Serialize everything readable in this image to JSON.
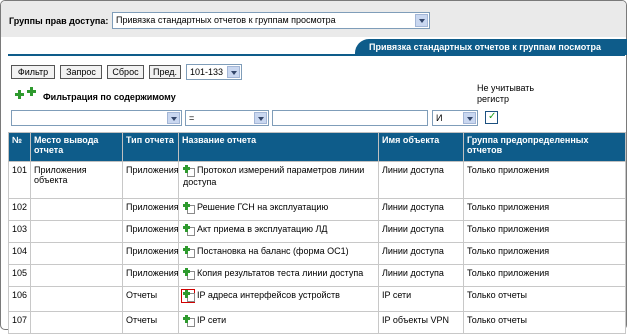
{
  "header": {
    "group_label": "Группы прав доступа:",
    "group_select_value": "Привязка стандартных отчетов к группам просмотра"
  },
  "title": "Привязка стандартных отчетов к группам посмотра",
  "toolbar": {
    "filter_label": "Фильтр",
    "query_label": "Запрос",
    "reset_label": "Сброс",
    "prev_label": "Пред.",
    "range_value": "101-133"
  },
  "filter": {
    "content_filter_label": "Фильтрация по содержимому",
    "operator_value": "=",
    "logic_value": "И",
    "ignore_case_label": "Не учитывать регистр",
    "ignore_case_checked": true
  },
  "table": {
    "columns": [
      "№",
      "Место вывода отчета",
      "Тип отчета",
      "Название отчета",
      "Имя объекта",
      "Группа предопределенных отчетов"
    ],
    "rows": [
      {
        "num": "101",
        "place": "Приложения объекта",
        "type": "Приложения",
        "name": "Протокол измерений параметров линии доступа",
        "object": "Линии доступа",
        "group": "Только приложения"
      },
      {
        "num": "102",
        "place": "",
        "type": "Приложения",
        "name": "Решение ГСН на эксплуатацию",
        "object": "Линии доступа",
        "group": "Только приложения"
      },
      {
        "num": "103",
        "place": "",
        "type": "Приложения",
        "name": "Акт приема в эксплуатацию ЛД",
        "object": "Линии доступа",
        "group": "Только приложения"
      },
      {
        "num": "104",
        "place": "",
        "type": "Приложения",
        "name": "Постановка на баланс (форма ОС1)",
        "object": "Линии доступа",
        "group": "Только приложения"
      },
      {
        "num": "105",
        "place": "",
        "type": "Приложения",
        "name": "Копия результатов теста линии доступа",
        "object": "Линии доступа",
        "group": "Только приложения"
      },
      {
        "num": "106",
        "place": "",
        "type": "Отчеты",
        "name": "IP адреса интерфейсов устройств",
        "object": "IP сети",
        "group": "Только отчеты"
      },
      {
        "num": "107",
        "place": "",
        "type": "Отчеты",
        "name": "IP сети",
        "object": "IP объекты VPN",
        "group": "Только отчеты"
      }
    ]
  }
}
